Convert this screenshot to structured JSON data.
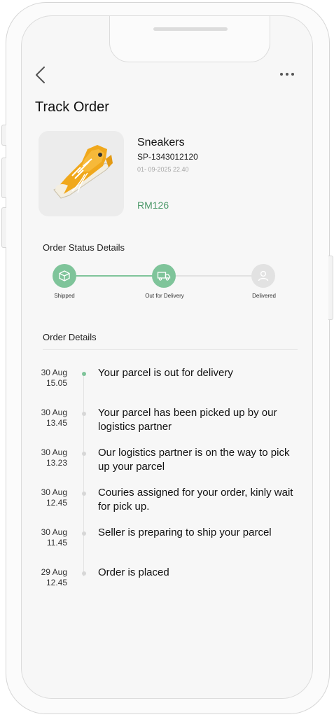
{
  "header": {
    "back_icon": "chevron-left-icon",
    "more_icon": "more-horizontal-icon",
    "title": "Track Order"
  },
  "product": {
    "image_icon": "sneaker-image",
    "name": "Sneakers",
    "sku": "SP-1343012120",
    "datetime": "01- 09-2025 22.40",
    "price": "RM126"
  },
  "status": {
    "heading": "Order Status Details",
    "steps": [
      {
        "label": "Shipped",
        "icon": "package-icon",
        "state": "done"
      },
      {
        "label": "Out for Delivery",
        "icon": "truck-icon",
        "state": "done"
      },
      {
        "label": "Delivered",
        "icon": "user-icon",
        "state": "pending"
      }
    ]
  },
  "details": {
    "heading": "Order Details",
    "events": [
      {
        "date": "30 Aug",
        "time": "15.05",
        "text": "Your parcel is out for delivery",
        "active": true
      },
      {
        "date": "30 Aug",
        "time": "13.45",
        "text": "Your parcel has been picked up by our logistics partner",
        "active": false
      },
      {
        "date": "30 Aug",
        "time": "13.23",
        "text": "Our logistics partner is on the way to pick up your parcel",
        "active": false
      },
      {
        "date": "30 Aug",
        "time": "12.45",
        "text": "Couries assigned for your order, kinly wait for pick up.",
        "active": false
      },
      {
        "date": "30 Aug",
        "time": "11.45",
        "text": "Seller is preparing to ship your parcel",
        "active": false
      },
      {
        "date": "29 Aug",
        "time": "12.45",
        "text": "Order is placed",
        "active": false
      }
    ]
  },
  "colors": {
    "accent": "#7fc49a",
    "price": "#4e9a6b",
    "pending": "#e2e2e2"
  }
}
